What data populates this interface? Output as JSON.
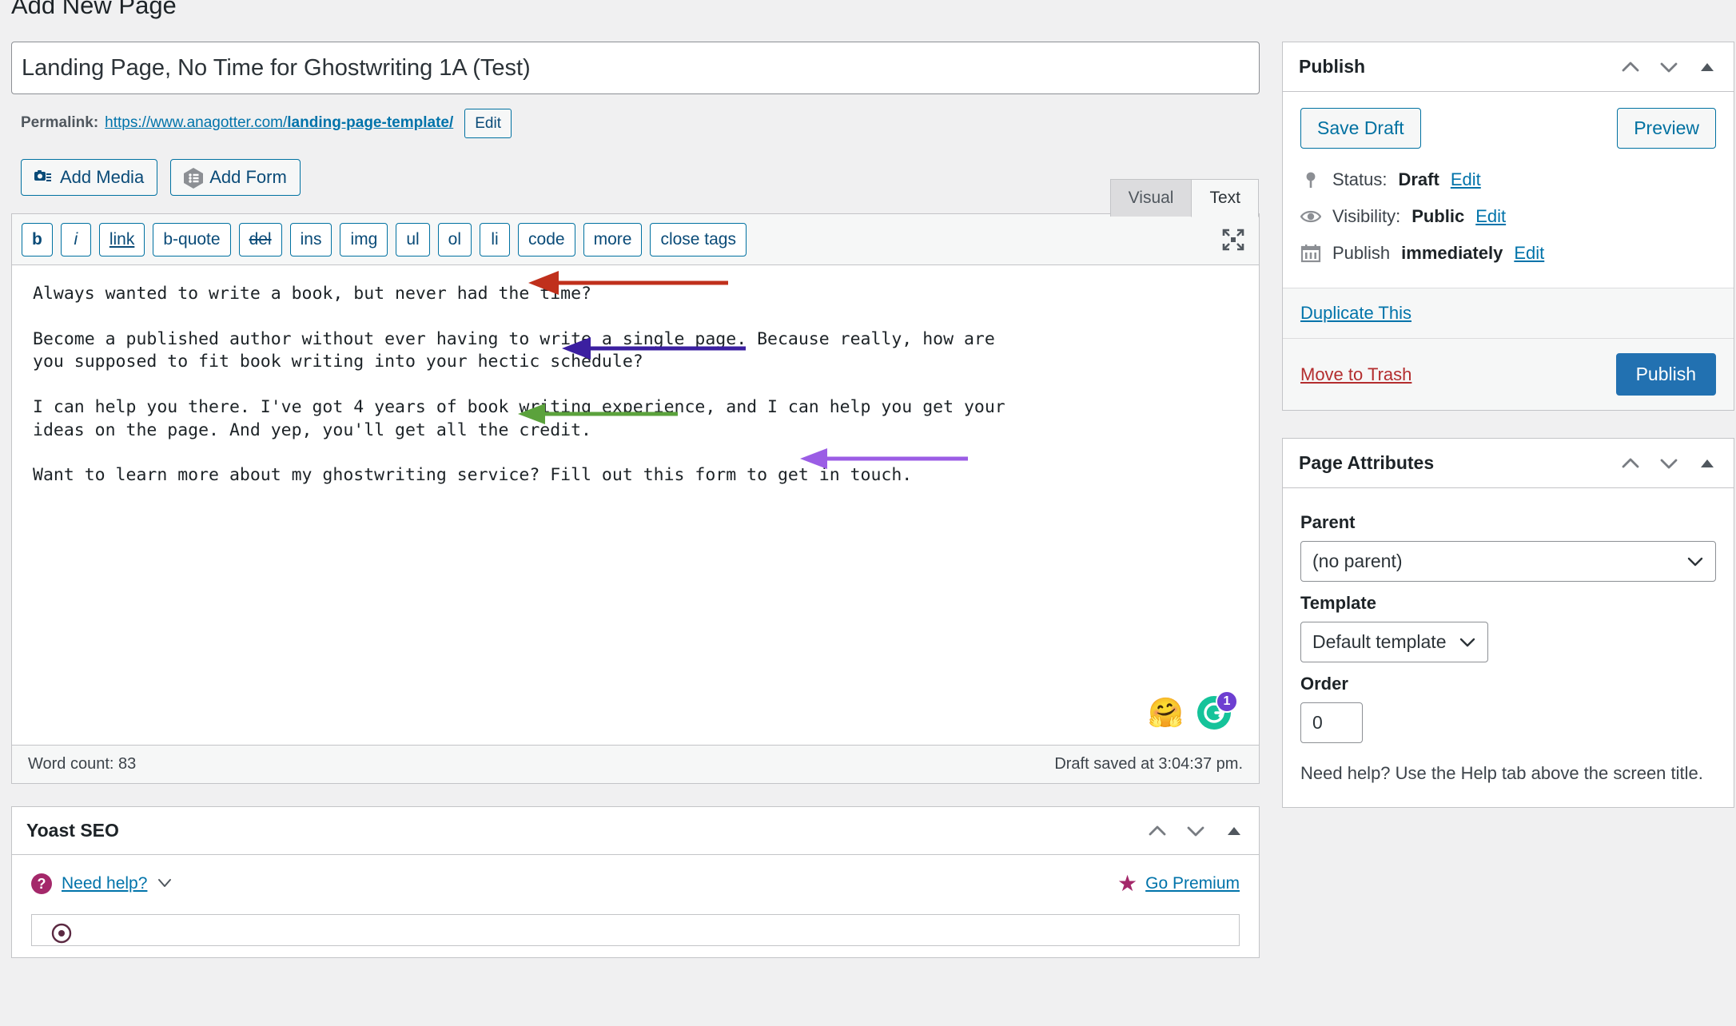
{
  "header": {
    "page_title": "Add New Page"
  },
  "title_field": {
    "value": "Landing Page, No Time for Ghostwriting 1A (Test)"
  },
  "permalink": {
    "label": "Permalink:",
    "base": "https://www.anagotter.com/",
    "slug": "landing-page-template/",
    "edit_button": "Edit"
  },
  "media_buttons": {
    "add_media": "Add Media",
    "add_form": "Add Form"
  },
  "editor_tabs": {
    "visual": "Visual",
    "text": "Text",
    "active": "Text"
  },
  "quicktags": [
    {
      "label": "b",
      "style": "bold"
    },
    {
      "label": "i",
      "style": "italic"
    },
    {
      "label": "link",
      "style": "underline"
    },
    {
      "label": "b-quote",
      "style": ""
    },
    {
      "label": "del",
      "style": "strike"
    },
    {
      "label": "ins",
      "style": ""
    },
    {
      "label": "img",
      "style": ""
    },
    {
      "label": "ul",
      "style": ""
    },
    {
      "label": "ol",
      "style": ""
    },
    {
      "label": "li",
      "style": ""
    },
    {
      "label": "code",
      "style": ""
    },
    {
      "label": "more",
      "style": ""
    },
    {
      "label": "close tags",
      "style": ""
    }
  ],
  "editor_content": {
    "p1": "Always wanted to write a book, but never had the time?",
    "p2": "Become a published author without ever having to write a single page. Because really, how are\nyou supposed to fit book writing into your hectic schedule?",
    "p3": "I can help you there. I've got 4 years of book writing experience, and I can help you get your\nideas on the page. And yep, you'll get all the credit.",
    "p4": "Want to learn more about my ghostwriting service? Fill out this form to get in touch."
  },
  "editor_icons": {
    "emoji": "🤗",
    "grammarly_letter": "G",
    "grammarly_badge": "1"
  },
  "status_bar": {
    "word_count": "Word count: 83",
    "draft_saved": "Draft saved at 3:04:37 pm."
  },
  "annotations": {
    "arrow1_color": "#c0301c",
    "arrow2_color": "#3b1fa0",
    "arrow3_color": "#5ba23c",
    "arrow4_color": "#9b5de5"
  },
  "yoast": {
    "title": "Yoast SEO",
    "need_help": "Need help?",
    "go_premium": "Go Premium"
  },
  "publish": {
    "title": "Publish",
    "save_draft": "Save Draft",
    "preview": "Preview",
    "status_label": "Status:",
    "status_value": "Draft",
    "status_edit": "Edit",
    "visibility_label": "Visibility:",
    "visibility_value": "Public",
    "visibility_edit": "Edit",
    "schedule_label": "Publish",
    "schedule_value": "immediately",
    "schedule_edit": "Edit",
    "duplicate": "Duplicate This",
    "move_to_trash": "Move to Trash",
    "publish_button": "Publish"
  },
  "page_attributes": {
    "title": "Page Attributes",
    "parent_label": "Parent",
    "parent_value": "(no parent)",
    "template_label": "Template",
    "template_value": "Default template",
    "order_label": "Order",
    "order_value": "0",
    "help_text": "Need help? Use the Help tab above the screen title."
  }
}
